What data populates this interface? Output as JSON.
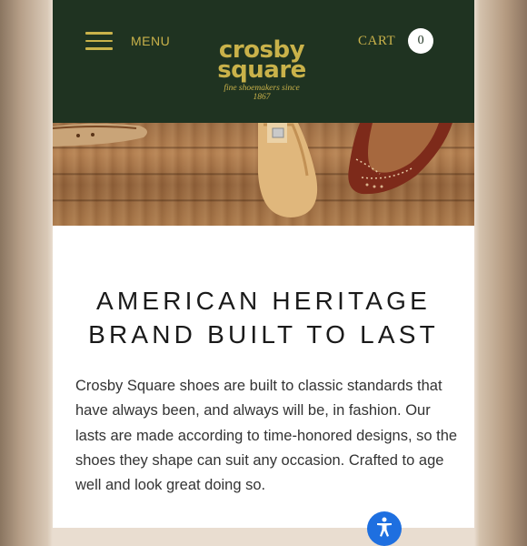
{
  "header": {
    "menu_label": "MENU",
    "logo": {
      "line1": "crosby",
      "line2": "square",
      "tagline": "fine shoemakers since",
      "year": "1867"
    },
    "cart_label": "CART",
    "cart_count": "0"
  },
  "colors": {
    "header_bg": "#1f3321",
    "brand_gold": "#c9b24a",
    "accessibility_blue": "#1e6fe0"
  },
  "hero": {
    "icons": [
      "shoe-tree-icon",
      "wingtip-shoe-icon"
    ]
  },
  "content": {
    "headline_line1": "AMERICAN HERITAGE",
    "headline_line2": "BRAND BUILT TO LAST",
    "body": "Crosby Square shoes are built to classic standards that have always been, and always will be, in fashion. Our lasts are made according to time-honored designs, so the shoes they shape can suit any occasion. Crafted to age well and look great doing so."
  },
  "accessibility": {
    "icon": "accessibility-icon"
  }
}
